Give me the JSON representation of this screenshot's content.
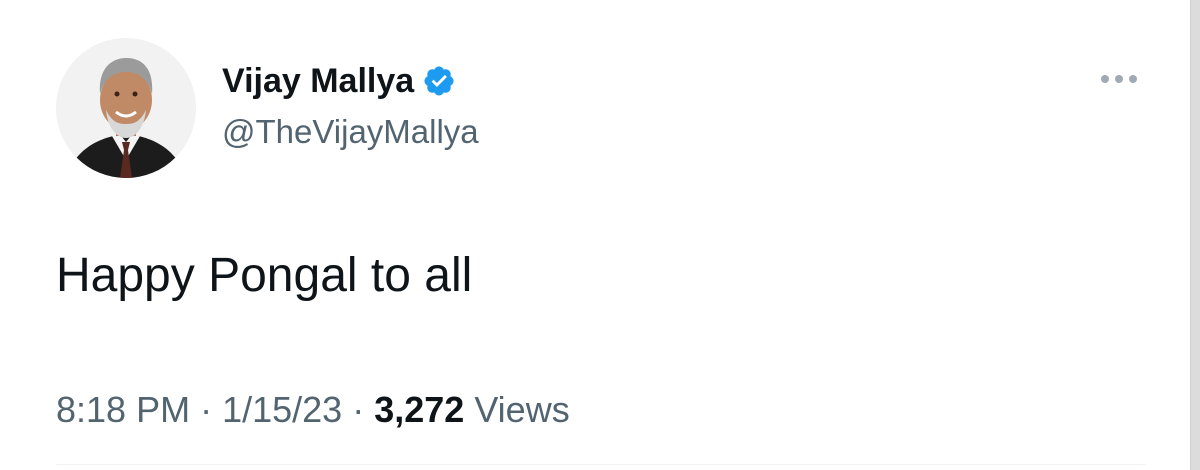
{
  "author": {
    "display_name": "Vijay Mallya",
    "handle": "@TheVijayMallya",
    "verified": true,
    "verified_color": "#1d9bf0"
  },
  "tweet": {
    "text": "Happy Pongal to all"
  },
  "meta": {
    "time": "8:18 PM",
    "separator": "·",
    "date": "1/15/23",
    "views_count": "3,272",
    "views_label": "Views"
  },
  "icons": {
    "more": "more-horizontal-icon",
    "verified": "verified-badge-icon"
  }
}
